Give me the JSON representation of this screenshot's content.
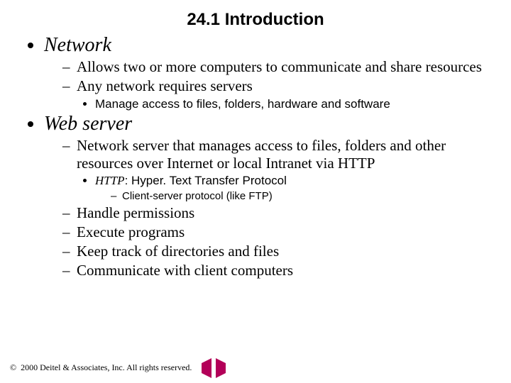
{
  "title": "24.1 Introduction",
  "top": [
    {
      "label": "Network",
      "sub": [
        {
          "text": "Allows two or more computers to communicate and share resources"
        },
        {
          "text": "Any network requires servers",
          "sub": [
            {
              "text": "Manage access to files, folders, hardware and software"
            }
          ]
        }
      ]
    },
    {
      "label": "Web server",
      "sub": [
        {
          "text": "Network server that manages access to files, folders and other resources over Internet or local Intranet via HTTP",
          "sub": [
            {
              "http_term": "HTTP",
              "http_rest": ": Hyper. Text Transfer Protocol",
              "sub": [
                {
                  "text": "Client-server protocol (like FTP)"
                }
              ]
            }
          ]
        },
        {
          "text": "Handle permissions"
        },
        {
          "text": "Execute programs"
        },
        {
          "text": "Keep track of directories and files"
        },
        {
          "text": "Communicate with client computers"
        }
      ]
    }
  ],
  "footer": {
    "copyright_symbol": "©",
    "text": "2000 Deitel & Associates, Inc.  All rights reserved."
  }
}
